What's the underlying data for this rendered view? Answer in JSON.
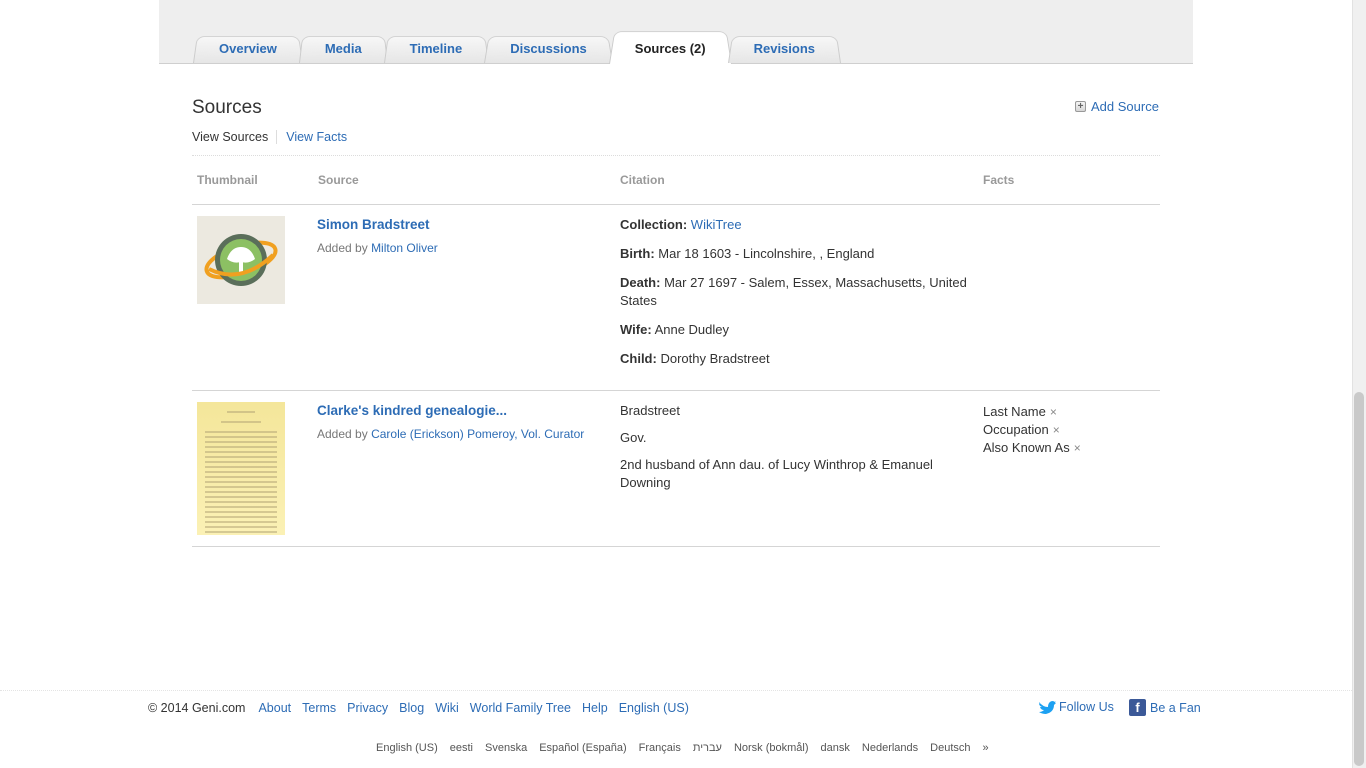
{
  "tabs": [
    {
      "label": "Overview",
      "active": false
    },
    {
      "label": "Media",
      "active": false
    },
    {
      "label": "Timeline",
      "active": false
    },
    {
      "label": "Discussions",
      "active": false
    },
    {
      "label": "Sources (2)",
      "active": true
    },
    {
      "label": "Revisions",
      "active": false
    }
  ],
  "section": {
    "title": "Sources",
    "add_label": "Add Source",
    "add_icon": "plus-box-icon",
    "view_current": "View Sources",
    "view_other": "View Facts"
  },
  "columns": {
    "thumbnail": "Thumbnail",
    "source": "Source",
    "citation": "Citation",
    "facts": "Facts"
  },
  "rows": [
    {
      "thumbnail_icon": "wikitree-logo-icon",
      "title": "Simon Bradstreet",
      "added_prefix": "Added by",
      "added_by": "Milton Oliver",
      "citation": {
        "collection_label": "Collection:",
        "collection_value": "WikiTree",
        "birth_label": "Birth:",
        "birth_value": "Mar 18 1603 - Lincolnshire, , England",
        "death_label": "Death:",
        "death_value": "Mar 27 1697 - Salem, Essex, Massachusetts, United States",
        "wife_label": "Wife:",
        "wife_value": "Anne Dudley",
        "child_label": "Child:",
        "child_value": "Dorothy Bradstreet"
      },
      "facts": []
    },
    {
      "thumbnail_icon": "document-page-icon",
      "title": "Clarke's kindred genealogie...",
      "added_prefix": "Added by",
      "added_by": "Carole (Erickson) Pomeroy, Vol. Curator",
      "citation": {
        "line1": "Bradstreet",
        "line2": "Gov.",
        "line3": "2nd husband of Ann dau. of Lucy Winthrop & Emanuel Downing"
      },
      "facts": [
        "Last Name",
        "Occupation",
        "Also Known As"
      ],
      "remove_glyph": "×"
    }
  ],
  "footer": {
    "copyright": "© 2014 Geni.com",
    "links": [
      "About",
      "Terms",
      "Privacy",
      "Blog",
      "Wiki",
      "World Family Tree",
      "Help",
      "English (US)"
    ],
    "follow_label": "Follow Us",
    "fan_label": "Be a Fan",
    "fan_icon_glyph": "f",
    "languages": [
      "English (US)",
      "eesti",
      "Svenska",
      "Español (España)",
      "Français",
      "עברית",
      "Norsk (bokmål)",
      "dansk",
      "Nederlands",
      "Deutsch",
      "»"
    ]
  },
  "colors": {
    "link": "#2d6cb5",
    "header_band": "#eeeeee",
    "facebook": "#3b5998",
    "twitter": "#1da1f2"
  }
}
